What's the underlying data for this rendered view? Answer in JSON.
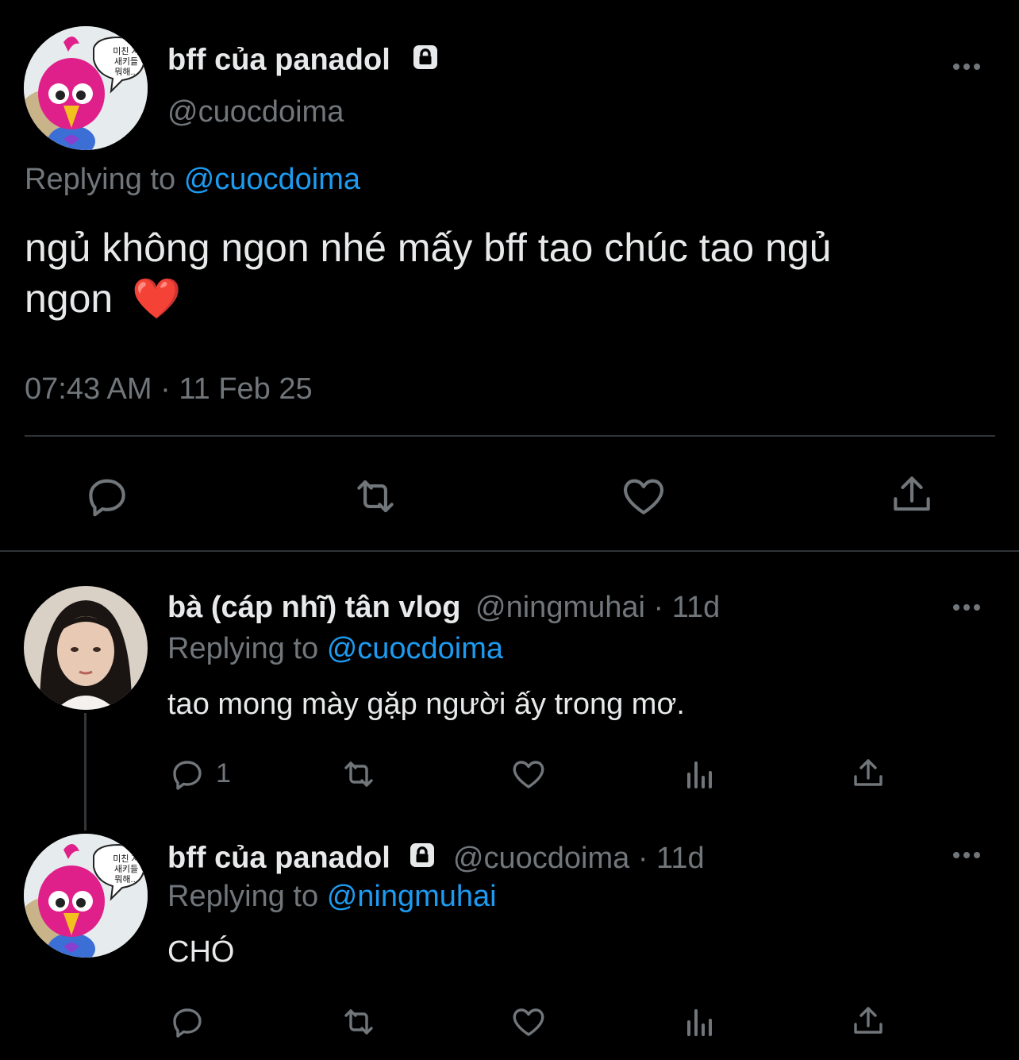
{
  "main_tweet": {
    "display_name": "bff của panadol",
    "handle": "@cuocdoima",
    "replying_prefix": "Replying to",
    "replying_handle": "@cuocdoima",
    "text_line1": "ngủ không ngon nhé mấy bff tao chúc tao ngủ",
    "text_line2": "ngon",
    "emoji": "❤️",
    "timestamp": "07:43 AM · 11 Feb 25",
    "avatar_speech": "미친 자\n새키들\n뭐해..."
  },
  "reply1": {
    "display_name": "bà (cáp nhĩ) tân vlog",
    "handle_time": "@ningmuhai · 11d",
    "replying_prefix": "Replying to",
    "replying_handle": "@cuocdoima",
    "text": "tao mong mày gặp người ấy trong mơ.",
    "reply_count": "1"
  },
  "reply2": {
    "display_name": "bff của panadol",
    "handle_time": "@cuocdoima · 11d",
    "replying_prefix": "Replying to",
    "replying_handle": "@ningmuhai",
    "text": "CHÓ",
    "avatar_speech": "미친 자\n새키들\n뭐해..."
  },
  "icons": {
    "reply": "reply-icon",
    "retweet": "retweet-icon",
    "like": "heart-icon",
    "views": "views-icon",
    "share": "share-icon",
    "lock": "lock-icon",
    "more": "more-icon"
  },
  "colors": {
    "background": "#000000",
    "text": "#e7e9ea",
    "muted": "#71767b",
    "link": "#1d9bf0",
    "divider": "#2f3336"
  }
}
